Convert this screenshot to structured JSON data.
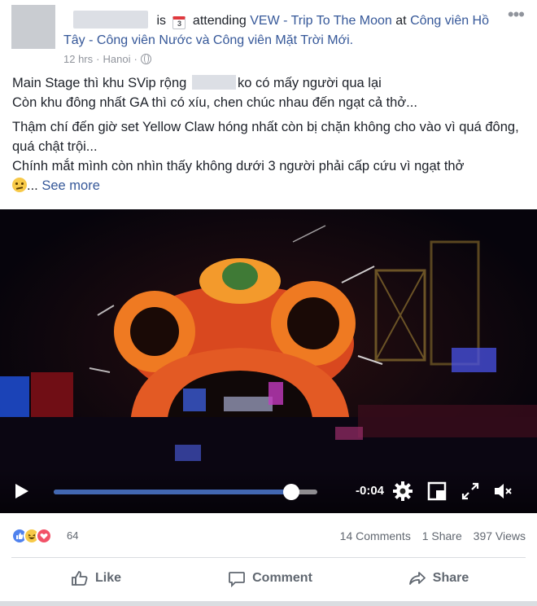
{
  "post": {
    "header": {
      "verb": "is",
      "calendar_day": "3",
      "activity": "attending",
      "event": "VEW - Trip To The Moon",
      "at": "at",
      "place": "Công viên Hồ Tây - Công viên Nước và Công viên Mặt Trời Mới.",
      "time": "12 hrs",
      "location": "Hanoi",
      "privacy_icon": "globe-icon",
      "more_icon": "more-icon"
    },
    "text": {
      "line1_a": "Main Stage thì khu SVip rộng",
      "line1_b": "ko có mấy người qua lại",
      "line2": "Còn khu đông nhất GA thì có xíu, chen chúc nhau đến ngạt cả thở...",
      "line3": "Thậm chí đến giờ set Yellow Claw hóng nhất còn bị chặn không cho vào vì quá đông, quá chật trội...",
      "line4": "Chính mắt mình còn nhìn thấy không dưới 3 người phải cấp cứu vì ngạt thở",
      "ellipsis": "...",
      "see_more": "See more"
    },
    "video": {
      "time_remaining": "-0:04",
      "progress": 0.9,
      "icons": [
        "play-icon",
        "gear-icon",
        "pip-icon",
        "expand-icon",
        "volume-muted-icon"
      ],
      "accent": "#4267b2"
    },
    "stats": {
      "reaction_count": "64",
      "comments": "14 Comments",
      "shares": "1 Share",
      "views": "397 Views"
    },
    "actions": {
      "like": "Like",
      "comment": "Comment",
      "share": "Share"
    }
  }
}
